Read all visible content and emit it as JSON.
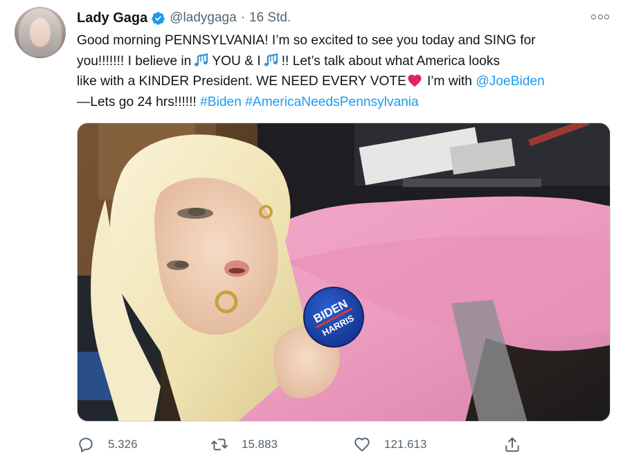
{
  "tweet": {
    "author": {
      "name": "Lady Gaga",
      "handle": "@ladygaga",
      "separator": "·",
      "time": "16 Std.",
      "verified_icon": "verified-badge-icon",
      "avatar_icon": "profile-photo"
    },
    "more_icon": "more-options-icon",
    "text": {
      "line1": "Good morning PENNSYLVANIA! I’m so excited to see you today and SING for",
      "line2_a": "you!!!!!!! I believe in",
      "line2_b": "YOU & I",
      "line2_c": "!! Let’s talk about what America looks",
      "line3_a": "like with a KINDER President. WE NEED EVERY VOTE",
      "line3_b": "I’m with",
      "mention": "@JoeBiden",
      "line4_a": "—Lets go 24 hrs!!!!!!",
      "hashtag1": "#Biden",
      "hashtag2": "#AmericaNeedsPennsylvania",
      "emoji_note": "musical-notes-emoji",
      "emoji_heart": "red-heart-emoji"
    },
    "media": {
      "description_icon": "photo",
      "button_text_1": "BIDEN",
      "button_text_2": "HARRIS"
    },
    "actions": {
      "reply": {
        "icon": "reply-icon",
        "count": "5.326"
      },
      "retweet": {
        "icon": "retweet-icon",
        "count": "15.883"
      },
      "like": {
        "icon": "like-heart-icon",
        "count": "121.613"
      },
      "share": {
        "icon": "share-icon"
      }
    },
    "colors": {
      "link": "#1d9bf0",
      "secondary": "#536471",
      "verified": "#1d9bf0",
      "heart": "#e0245e"
    }
  }
}
